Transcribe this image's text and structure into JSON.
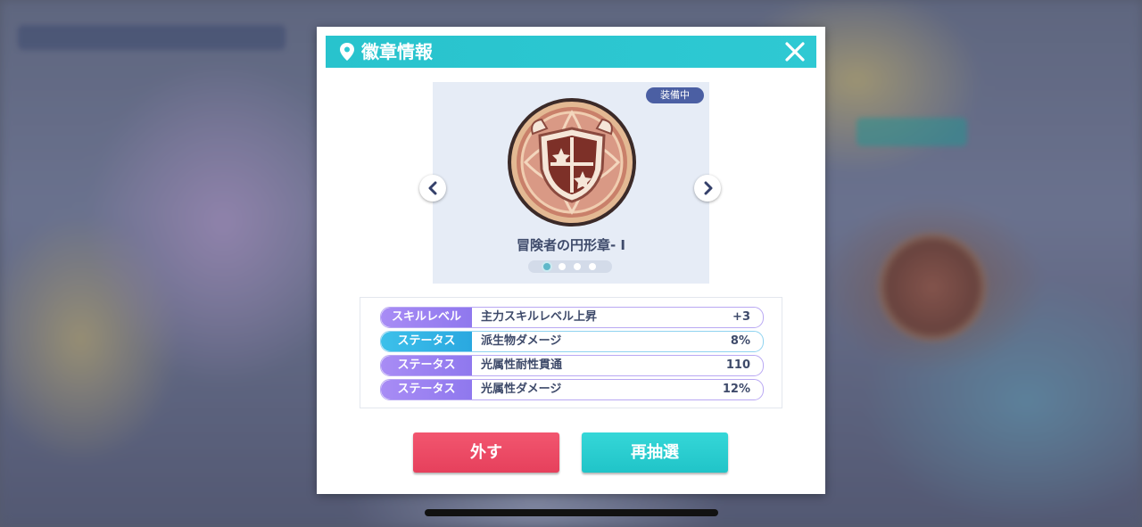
{
  "dialog": {
    "title": "徽章情報",
    "close_icon": "close-icon",
    "header_color": "#2ec9d3"
  },
  "badge": {
    "equipped_tag": "装備中",
    "name": "冒険者の円形章- I",
    "page_count": 4,
    "active_page": 1
  },
  "stats": [
    {
      "tag": "スキルレベル",
      "tag_color": "#9b7cf0",
      "description": "主力スキルレベル上昇",
      "value": "+3"
    },
    {
      "tag": "ステータス",
      "tag_color": "#36b6e6",
      "description": "派生物ダメージ",
      "value": "8%"
    },
    {
      "tag": "ステータス",
      "tag_color": "#9b7cf0",
      "description": "光属性耐性貫通",
      "value": "110"
    },
    {
      "tag": "ステータス",
      "tag_color": "#9b7cf0",
      "description": "光属性ダメージ",
      "value": "12%"
    }
  ],
  "buttons": {
    "remove": "外す",
    "reroll": "再抽選",
    "remove_color": "#e6405c",
    "reroll_color": "#20c4c8"
  }
}
